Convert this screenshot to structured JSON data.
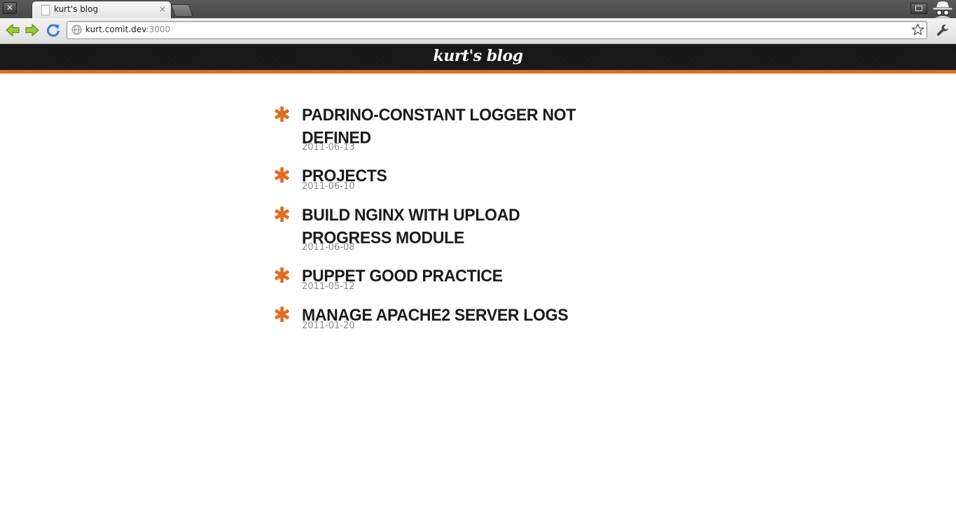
{
  "browser": {
    "tab_title": "kurt's blog",
    "tab_close_glyph": "×",
    "window_close_glyph": "✕",
    "url_host": "kurt.comit.dev",
    "url_port": ":3000"
  },
  "site": {
    "title": "kurt's blog",
    "accent_color": "#e36b1e",
    "header_color": "#141414"
  },
  "posts": [
    {
      "bullet": "✱",
      "title": "PADRINO-CONSTANT LOGGER NOT DEFINED",
      "date": "2011-06-13"
    },
    {
      "bullet": "✱",
      "title": "PROJECTS",
      "date": "2011-06-10"
    },
    {
      "bullet": "✱",
      "title": "BUILD NGINX WITH UPLOAD PROGRESS MODULE",
      "date": "2011-06-08"
    },
    {
      "bullet": "✱",
      "title": "PUPPET GOOD PRACTICE",
      "date": "2011-05-12"
    },
    {
      "bullet": "✱",
      "title": "MANAGE APACHE2 SERVER LOGS",
      "date": "2011-01-20"
    }
  ],
  "icons": {
    "back": "back-arrow-icon",
    "forward": "forward-arrow-icon",
    "reload": "reload-icon",
    "globe": "globe-icon",
    "bookmark": "star-icon",
    "settings": "wrench-icon",
    "incognito": "incognito-icon"
  }
}
